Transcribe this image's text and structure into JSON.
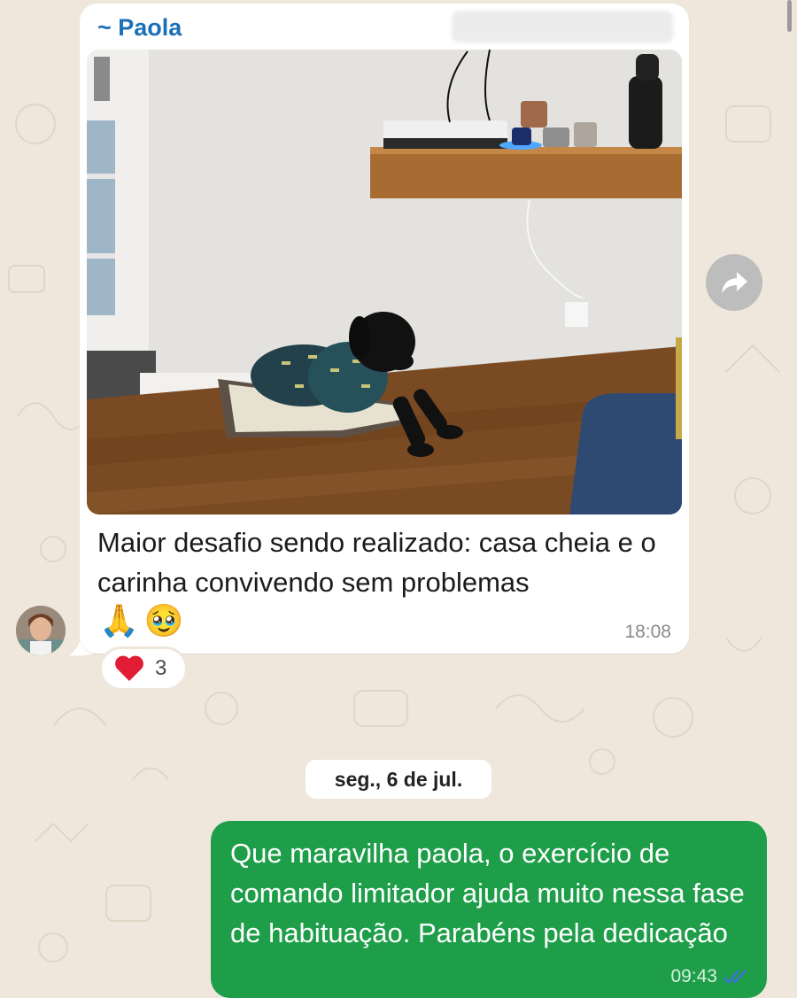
{
  "incoming": {
    "sender": "~ Paola",
    "caption": "Maior desafio sendo realizado: casa cheia e o carinha convivendo sem problemas",
    "emojis": [
      "🙏",
      "🥹"
    ],
    "time": "18:08",
    "reaction": {
      "emoji": "❤️",
      "count": "3"
    }
  },
  "date_separator": "seg., 6 de jul.",
  "outgoing": {
    "text": "Que maravilha paola, o exercício de comando limitador ajuda muito nessa fase de habituação. Parabéns pela dedicação",
    "time": "09:43",
    "status": "read"
  },
  "colors": {
    "background": "#efe7dc",
    "sender_name": "#1a6fb7",
    "outgoing_bubble": "#1f9e4a",
    "read_ticks": "#3a6fd8"
  },
  "icons": [
    "forward-icon",
    "double-check-icon",
    "heart-icon"
  ]
}
